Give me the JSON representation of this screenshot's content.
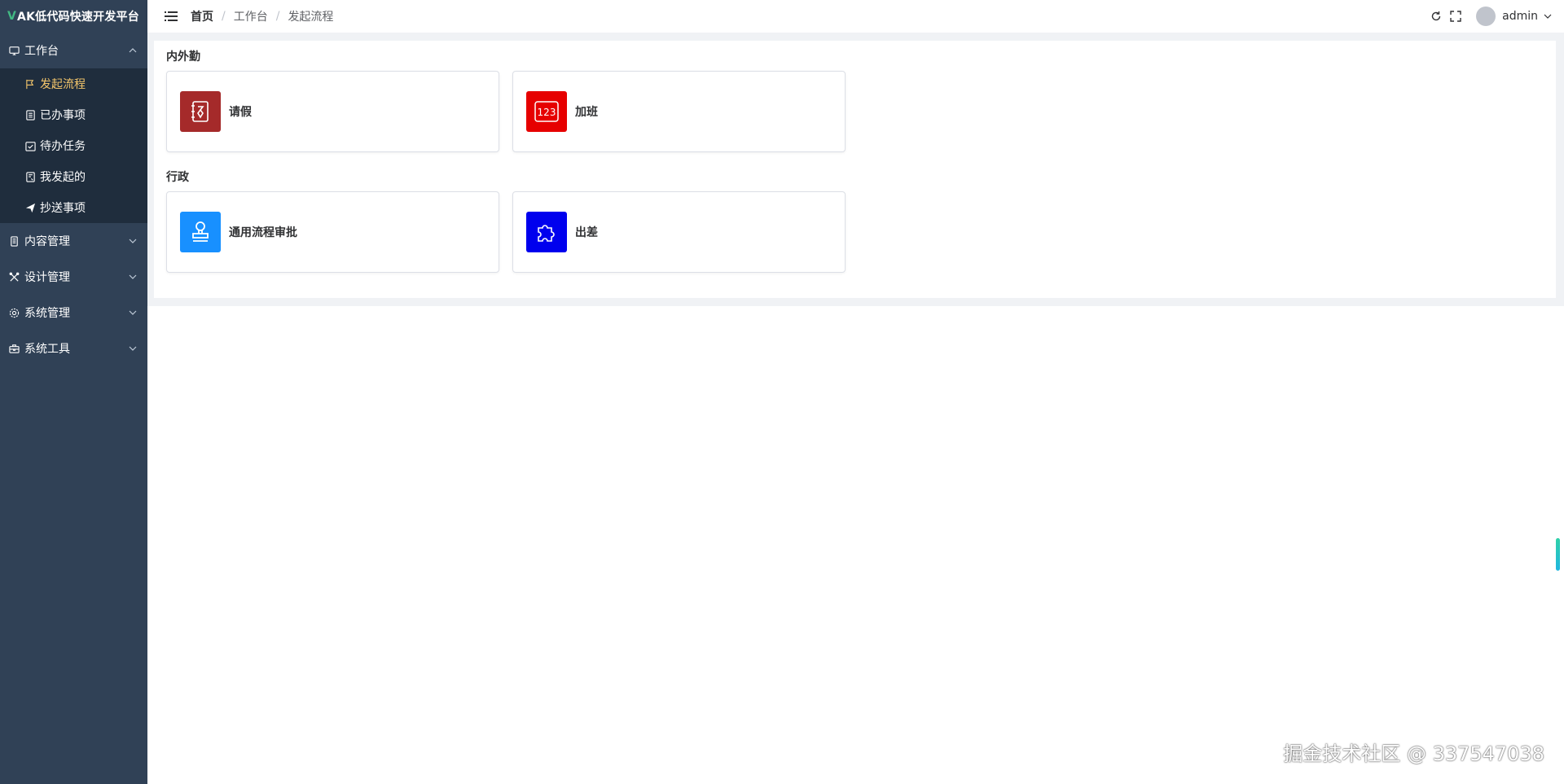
{
  "brand": {
    "v": "V",
    "rest": "AK低代码快速开发平台"
  },
  "sidebar": {
    "groups": [
      {
        "label": "工作台",
        "icon": "monitor-icon",
        "expanded": true,
        "items": [
          {
            "label": "发起流程",
            "icon": "flag-icon",
            "active": true
          },
          {
            "label": "已办事项",
            "icon": "document-icon"
          },
          {
            "label": "待办任务",
            "icon": "calendar-check-icon"
          },
          {
            "label": "我发起的",
            "icon": "notes-icon"
          },
          {
            "label": "抄送事项",
            "icon": "send-icon"
          }
        ]
      },
      {
        "label": "内容管理",
        "icon": "files-icon"
      },
      {
        "label": "设计管理",
        "icon": "tools-icon"
      },
      {
        "label": "系统管理",
        "icon": "gear-icon"
      },
      {
        "label": "系统工具",
        "icon": "toolbox-icon"
      }
    ]
  },
  "header": {
    "breadcrumb": [
      "首页",
      "工作台",
      "发起流程"
    ],
    "username": "admin"
  },
  "sections": [
    {
      "title": "内外勤",
      "cards": [
        {
          "name": "请假",
          "color": "#a52a2a",
          "icon": "leave-icon"
        },
        {
          "name": "加班",
          "color": "#e60000",
          "icon": "number-123-icon"
        }
      ]
    },
    {
      "title": "行政",
      "cards": [
        {
          "name": "通用流程审批",
          "color": "#1890ff",
          "icon": "stamp-icon"
        },
        {
          "name": "出差",
          "color": "#0000ee",
          "icon": "puzzle-icon"
        }
      ]
    }
  ],
  "watermark": "掘金技术社区 @ 337547038",
  "colors": {
    "sidebar_bg": "#304156",
    "active": "#f4c66b"
  }
}
